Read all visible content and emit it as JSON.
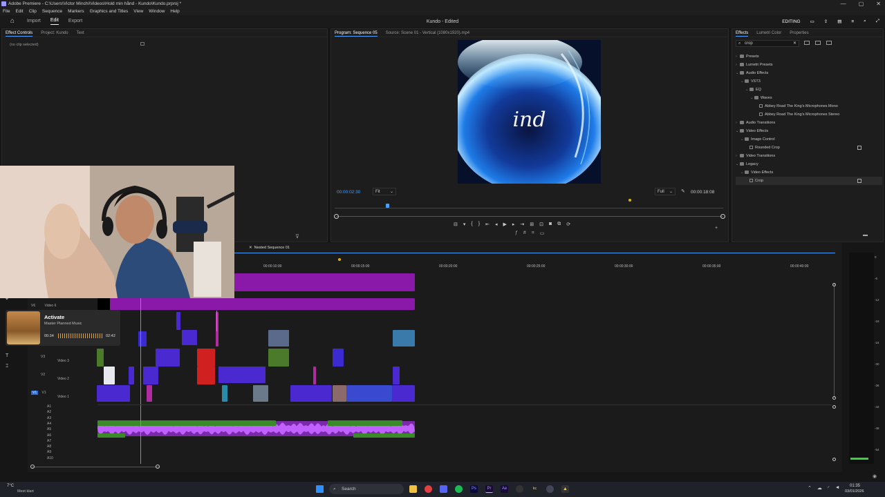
{
  "window": {
    "title": "Adobe Premiere - C:\\Users\\Victor Minchi\\Videos\\Hold min hånd - Kundo\\Kundo.prproj *",
    "controls": [
      "—",
      "▢",
      "✕"
    ]
  },
  "menu": [
    "File",
    "Edit",
    "Clip",
    "Sequence",
    "Markers",
    "Graphics and Titles",
    "View",
    "Window",
    "Help"
  ],
  "header": {
    "workspaces": [
      "Import",
      "Edit",
      "Export"
    ],
    "active_workspace": "Edit",
    "doc_title": "Kundo - Edited",
    "workspace_label": "EDITING"
  },
  "left_panel": {
    "tabs": [
      "Effect Controls",
      "Project: Kundo",
      "Text"
    ],
    "empty_text": "(no clip selected)"
  },
  "monitor": {
    "tabs": [
      "Program: Sequence 05",
      "Source: Scene 01 - Vertical (1080x1920).mp4"
    ],
    "overlay_text": "ind",
    "current_time": "00:00:02:30",
    "zoom": "Fit",
    "quality": "Full",
    "duration": "00:00:18:08"
  },
  "effects_panel": {
    "tabs": [
      "Effects",
      "Lumetri Color",
      "Properties"
    ],
    "search_value": "crop",
    "tree": [
      {
        "label": "Presets",
        "indent": 0,
        "arrow": "›",
        "type": "folder"
      },
      {
        "label": "Lumetri Presets",
        "indent": 0,
        "arrow": "›",
        "type": "folder"
      },
      {
        "label": "Audio Effects",
        "indent": 0,
        "arrow": "⌄",
        "type": "folder"
      },
      {
        "label": "VST3",
        "indent": 1,
        "arrow": "⌄",
        "type": "folder"
      },
      {
        "label": "EQ",
        "indent": 2,
        "arrow": "⌄",
        "type": "folder"
      },
      {
        "label": "Waves",
        "indent": 3,
        "arrow": "⌄",
        "type": "folder"
      },
      {
        "label": "Abbey Road The King's Microphones Mono",
        "indent": 4,
        "arrow": "",
        "type": "fx"
      },
      {
        "label": "Abbey Road The King's Microphones Stereo",
        "indent": 4,
        "arrow": "",
        "type": "fx"
      },
      {
        "label": "Audio Transitions",
        "indent": 0,
        "arrow": "›",
        "type": "folder"
      },
      {
        "label": "Video Effects",
        "indent": 0,
        "arrow": "⌄",
        "type": "folder"
      },
      {
        "label": "Image Control",
        "indent": 1,
        "arrow": "⌄",
        "type": "folder"
      },
      {
        "label": "Rounded Crop",
        "indent": 2,
        "arrow": "",
        "type": "fx",
        "accel": true
      },
      {
        "label": "Video Transitions",
        "indent": 0,
        "arrow": "›",
        "type": "folder"
      },
      {
        "label": "Legacy",
        "indent": 0,
        "arrow": "⌄",
        "type": "folder"
      },
      {
        "label": "Video Effects",
        "indent": 1,
        "arrow": "⌄",
        "type": "folder"
      },
      {
        "label": "Crop",
        "indent": 2,
        "arrow": "",
        "type": "fx",
        "accel": true,
        "selected": true
      }
    ]
  },
  "timeline": {
    "sequence_tab": "Nested Sequence 01",
    "ruler": [
      "00:00:10:00",
      "00:00:15:00",
      "00:00:20:00",
      "00:00:25:00",
      "00:00:30:00",
      "00:00:35:00",
      "00:00:40:00"
    ],
    "tracks": [
      {
        "id": "V6",
        "name": "Video 6"
      },
      {
        "id": "V3",
        "name": "Video 3"
      },
      {
        "id": "V2",
        "name": "Video 2"
      },
      {
        "id": "V1",
        "name": "Video 1"
      }
    ],
    "audio_tracks": [
      "A1",
      "A2",
      "A3",
      "A4",
      "A5",
      "A6",
      "A7",
      "A8",
      "A9",
      "A10"
    ],
    "meter_scale": [
      "0",
      "-6",
      "-12",
      "-18",
      "-24",
      "-30",
      "-36",
      "-42",
      "-48",
      "-54"
    ]
  },
  "notification": {
    "title": "Activate",
    "subtitle": "Master Planned Music",
    "elapsed": "00:34",
    "total": "02:42"
  },
  "taskbar": {
    "weather_temp": "7°C",
    "weather_desc": "Mest klart",
    "search_placeholder": "Search",
    "time": "01:35",
    "date": "03/01/2026"
  },
  "colors": {
    "accent": "#4a9eff",
    "nested_clip": "#8a18a8",
    "video_clip": "#4a2ad0",
    "audio_clip": "#3b8a2a"
  }
}
